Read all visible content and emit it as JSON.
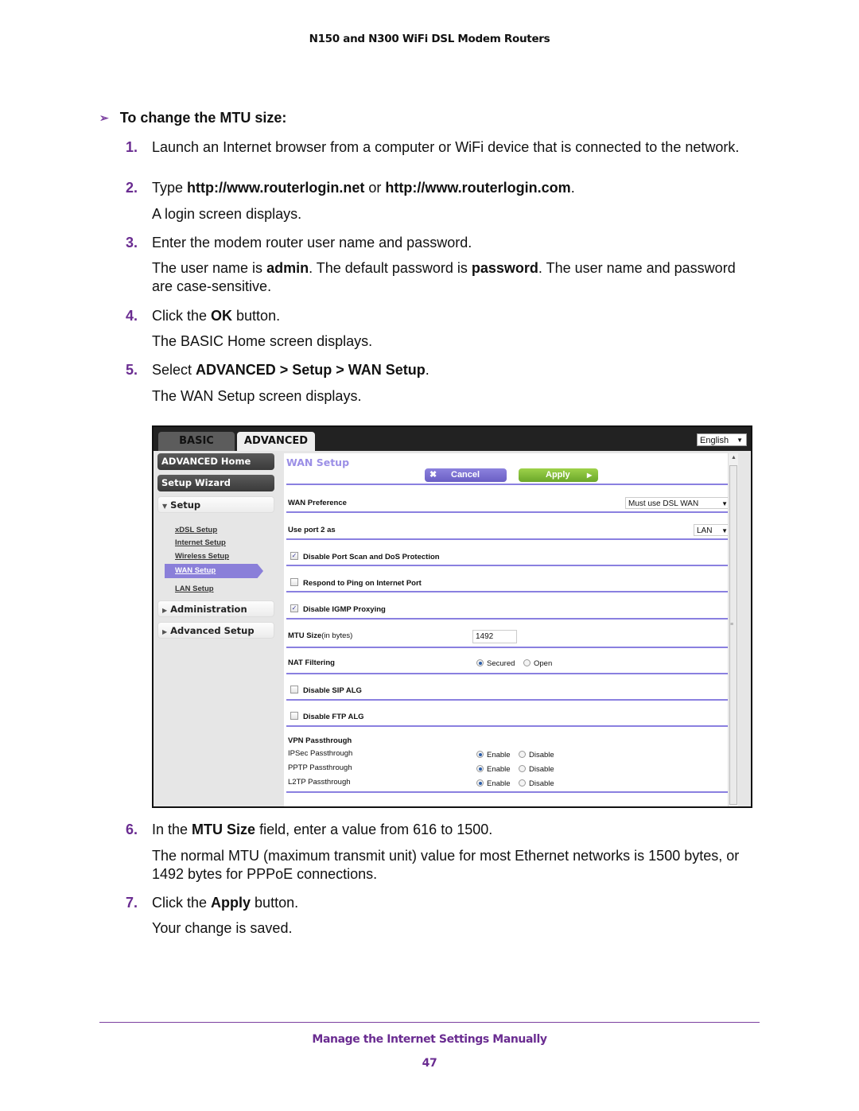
{
  "header": {
    "title": "N150 and N300 WiFi DSL Modem Routers"
  },
  "procedure": {
    "title": "To change the MTU size:",
    "arrow_icon": "➢",
    "steps": [
      {
        "num": "1.",
        "text": "Launch an Internet browser from a computer or WiFi device that is connected to the network."
      },
      {
        "num": "2.",
        "pre": "Type ",
        "bold1": "http://www.routerlogin.net",
        "mid": " or ",
        "bold2": "http://www.routerlogin.com",
        "post": ".",
        "note": "A login screen displays."
      },
      {
        "num": "3.",
        "text": "Enter the modem router user name and password.",
        "note_pre": "The user name is ",
        "note_b1": "admin",
        "note_mid": ". The default password is ",
        "note_b2": "password",
        "note_post": ". The user name and password are case-sensitive."
      },
      {
        "num": "4.",
        "pre": "Click the ",
        "bold": "OK",
        "post": " button.",
        "note": "The BASIC Home screen displays."
      },
      {
        "num": "5.",
        "pre": "Select ",
        "bold": "ADVANCED > Setup > WAN Setup",
        "post": ".",
        "note": "The WAN Setup screen displays."
      },
      {
        "num": "6.",
        "pre": "In the ",
        "bold": "MTU Size",
        "post": " field, enter a value from 616 to 1500.",
        "note": "The normal MTU (maximum transmit unit) value for most Ethernet networks is 1500 bytes, or 1492 bytes for PPPoE connections."
      },
      {
        "num": "7.",
        "pre": "Click the ",
        "bold": "Apply",
        "post": " button.",
        "note": "Your change is saved."
      }
    ]
  },
  "router_ui": {
    "tabs": {
      "basic": "BASIC",
      "advanced": "ADVANCED"
    },
    "language": "English",
    "sidebar": {
      "advanced_home": "ADVANCED Home",
      "setup_wizard": "Setup Wizard",
      "setup": "Setup",
      "setup_links": [
        "xDSL Setup",
        "Internet Setup",
        "Wireless Setup",
        "WAN Setup",
        "LAN Setup"
      ],
      "administration": "Administration",
      "advanced_setup": "Advanced Setup"
    },
    "page_title": "WAN Setup",
    "buttons": {
      "cancel": "Cancel",
      "apply": "Apply"
    },
    "fields": {
      "wan_preference_label": "WAN Preference",
      "wan_preference_value": "Must use DSL WAN",
      "use_port2_label": "Use port 2 as",
      "use_port2_value": "LAN",
      "disable_port_scan": "Disable Port Scan and DoS Protection",
      "disable_port_scan_checked": true,
      "respond_ping": "Respond to Ping on Internet Port",
      "respond_ping_checked": false,
      "disable_igmp": "Disable IGMP Proxying",
      "disable_igmp_checked": true,
      "mtu_label": "MTU Size",
      "mtu_unit": "(in bytes)",
      "mtu_value": "1492",
      "nat_label": "NAT Filtering",
      "nat_secured": "Secured",
      "nat_open": "Open",
      "nat_selected": "Secured",
      "disable_sip": "Disable SIP ALG",
      "disable_sip_checked": false,
      "disable_ftp": "Disable FTP ALG",
      "disable_ftp_checked": false,
      "vpn_label": "VPN Passthrough",
      "vpn_rows": [
        {
          "label": "IPSec Passthrough",
          "selected": "Enable"
        },
        {
          "label": "PPTP Passthrough",
          "selected": "Enable"
        },
        {
          "label": "L2TP Passthrough",
          "selected": "Enable"
        }
      ],
      "enable": "Enable",
      "disable": "Disable"
    }
  },
  "footer": {
    "section": "Manage the Internet Settings Manually",
    "page": "47"
  },
  "colors": {
    "accent_purple": "#6a2c91",
    "router_rule": "#8a80e0",
    "apply_green": "#7fbf38",
    "cancel_purple": "#7a6fd0"
  }
}
